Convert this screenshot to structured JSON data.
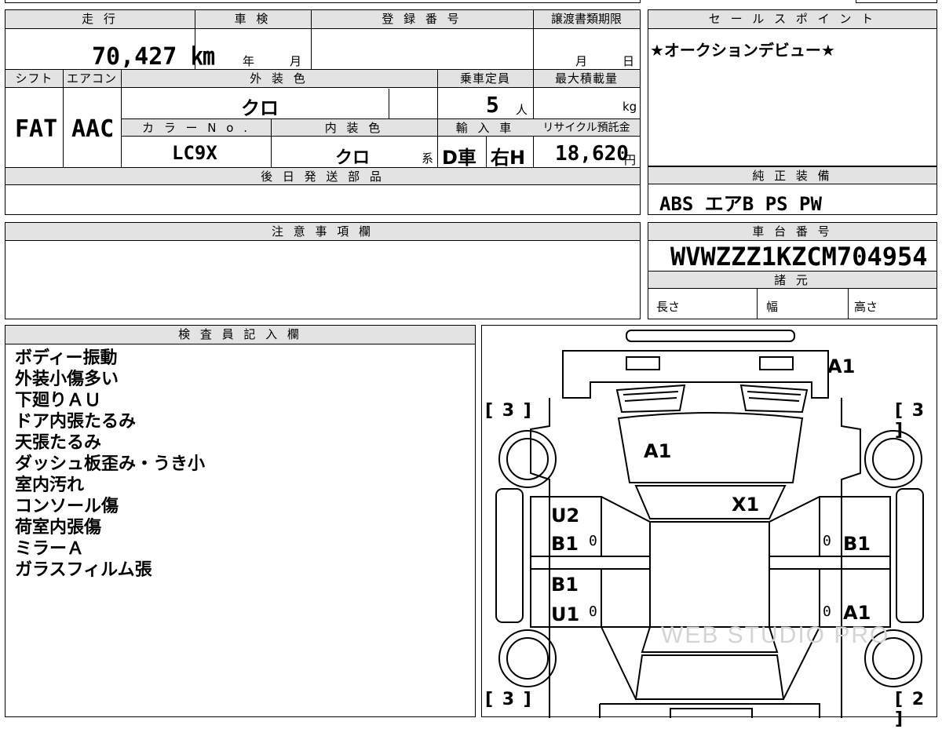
{
  "top": {
    "mileage_label": "走 行",
    "mileage_value": "70,427 ㎞",
    "inspection_label": "車 検",
    "inspection_year": "年",
    "inspection_month": "月",
    "registration_label": "登 録 番 号",
    "transfer_label": "譲渡書類期限",
    "transfer_month": "月",
    "transfer_day": "日",
    "shift_label": "シフト",
    "ac_label": "エアコン",
    "exterior_label": "外 装 色",
    "capacity_label": "乗車定員",
    "maxload_label": "最大積載量",
    "shift_value": "FAT",
    "ac_value": "AAC",
    "exterior_value": "クロ",
    "capacity_value": "5",
    "capacity_unit": "人",
    "maxload_unit": "kg",
    "color_no_label": "カ ラ ー N o .",
    "interior_label": "内 装 色",
    "import_label": "輸 入 車",
    "recycle_label": "リサイクル預託金",
    "color_no_value": "LC9X",
    "interior_value": "クロ",
    "interior_suffix": "系",
    "import_value_1": "D車",
    "import_value_2": "右H",
    "recycle_value": "18,620",
    "recycle_unit": "円",
    "later_parts_label": "後 日 発 送 部 品"
  },
  "sales": {
    "label": "セ ー ル ス ポ イ ン ト",
    "text": "★オークションデビュー★"
  },
  "equipment": {
    "label": "純 正 装 備",
    "value": "ABS エアB PS PW"
  },
  "caution": {
    "label": "注 意 事 項 欄"
  },
  "chassis": {
    "label": "車 台 番 号",
    "value": "WVWZZZ1KZCM704954",
    "specs_label": "諸 元",
    "length_label": "長さ",
    "width_label": "幅",
    "height_label": "高さ"
  },
  "inspector": {
    "label": "検 査 員 記 入 欄",
    "notes": [
      "ボディー振動",
      "外装小傷多い",
      "下廻りＡＵ",
      "ドア内張たるみ",
      "天張たるみ",
      "ダッシュ板歪み・うき小",
      "室内汚れ",
      "コンソール傷",
      "荷室内張傷",
      "ミラーＡ",
      "ガラスフィルム張"
    ]
  },
  "diagram": {
    "marks": {
      "front_bumper": "A1",
      "hood": "A1",
      "windshield": "X1",
      "left_front_door_1": "U2",
      "left_front_door_2": "B1",
      "left_rear_door_1": "B1",
      "left_rear_door_2": "U1",
      "right_front_door": "B1",
      "right_rear_door": "A1"
    },
    "zero_marks": "0",
    "tire_front_left": "[ 3 ]",
    "tire_front_right": "[ 3 ]",
    "tire_rear_left": "[ 3 ]",
    "tire_rear_right": "[ 2 ]",
    "watermark": "WEB STUDIO PRO"
  }
}
